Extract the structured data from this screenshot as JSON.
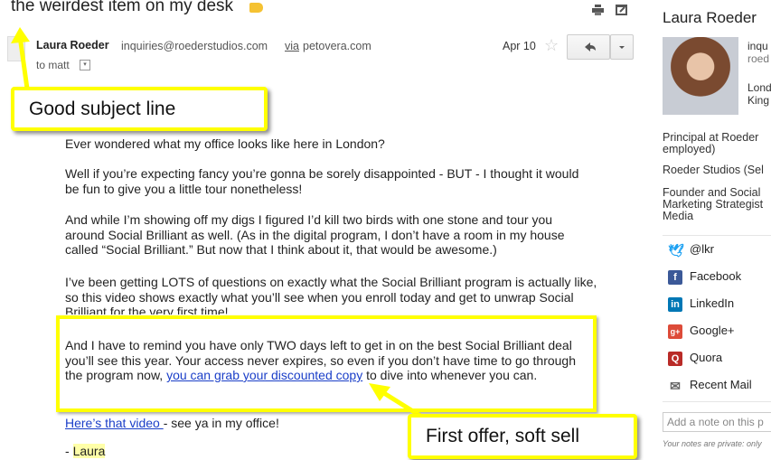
{
  "email": {
    "subject": "the weirdest item on my desk",
    "sender_name": "Laura Roeder",
    "sender_email": "inquiries@roederstudios.com",
    "via_word": "via",
    "via_domain": "petovera.com",
    "to_line": "to matt",
    "date": "Apr 10",
    "body": {
      "p1": "Ever wondered what my office looks like here in London?",
      "p2": "Well if you’re expecting fancy you’re gonna be sorely disappointed - BUT - I thought it would be fun to give you a little tour nonetheless!",
      "p3": "And while I’m showing off my digs I figured I’d kill two birds with one stone and tour you around Social Brilliant as well. (As in the digital program, I don’t have a room in my house called “Social Brilliant.” But now that I think about it, that would be awesome.)",
      "p4": "I’ve been getting LOTS of questions on exactly what the Social Brilliant program is actually like, so this video shows exactly what you’ll see when you enroll today and get to unwrap Social Brilliant for the very first time!",
      "p5_before": "And I have to remind you have only TWO days left to get in on the best Social Brilliant deal you’ll see this year. Your access never expires, so even if you don’t have time to go through the program now, ",
      "p5_link": "you can grab your discounted copy",
      "p5_after": " to dive into whenever you can.",
      "p6_link": "Here’s that video ",
      "p6_after": "- see ya in my office!",
      "sig_dash": "- ",
      "sig_name": "Laura"
    }
  },
  "callouts": {
    "subject_note": "Good subject line",
    "offer_note": "First offer, soft sell"
  },
  "sidebar": {
    "name": "Laura Roeder",
    "email_fragment_1": "inqu",
    "email_fragment_2": "roed",
    "location_1": "Lond",
    "location_2": "King",
    "roles": [
      "Principal at Roeder employed)",
      "Roeder Studios (Sel",
      "Founder and Social Marketing Strategist Media"
    ],
    "social": [
      {
        "label": "@lkr",
        "icon": "twitter-icon",
        "color": "#1da1f2"
      },
      {
        "label": "Facebook",
        "icon": "facebook-icon",
        "color": "#3b5998"
      },
      {
        "label": "LinkedIn",
        "icon": "linkedin-icon",
        "color": "#0077b5"
      },
      {
        "label": "Google+",
        "icon": "google-plus-icon",
        "color": "#dd4b39"
      },
      {
        "label": "Quora",
        "icon": "quora-icon",
        "color": "#b92b27"
      },
      {
        "label": "Recent Mail",
        "icon": "mail-icon",
        "color": "#666666"
      }
    ],
    "note_placeholder": "Add a note on this p",
    "note_help": "Your notes are private: only"
  }
}
